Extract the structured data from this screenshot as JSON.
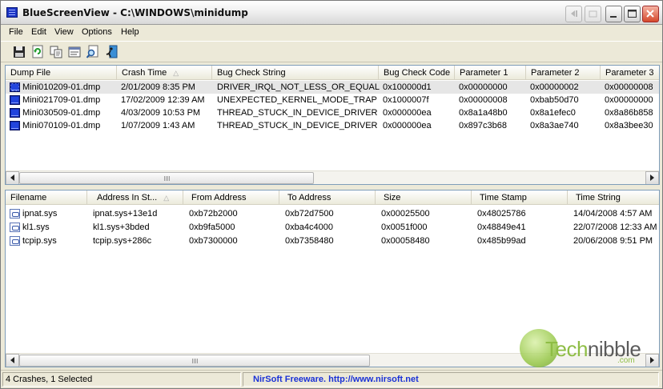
{
  "window": {
    "title": "BlueScreenView  -  C:\\WINDOWS\\minidump",
    "app_icon": "bluescreen-icon",
    "title_buttons": [
      "restore-icon",
      "unknown-icon",
      "minimize-icon",
      "maximize-icon",
      "close-icon"
    ]
  },
  "menu": {
    "file": "File",
    "edit": "Edit",
    "view": "View",
    "options": "Options",
    "help": "Help"
  },
  "toolbar": {
    "icons": [
      "save-icon",
      "refresh-icon",
      "copy-icon",
      "properties-icon",
      "find-icon",
      "exit-icon"
    ]
  },
  "crash_list": {
    "columns": [
      "Dump File",
      "Crash Time",
      "Bug Check String",
      "Bug Check Code",
      "Parameter 1",
      "Parameter 2",
      "Parameter 3"
    ],
    "sorted_column": "Crash Time",
    "rows": [
      [
        "Mini010209-01.dmp",
        "2/01/2009 8:35 PM",
        "DRIVER_IRQL_NOT_LESS_OR_EQUAL",
        "0x100000d1",
        "0x00000000",
        "0x00000002",
        "0x00000008"
      ],
      [
        "Mini021709-01.dmp",
        "17/02/2009 12:39 AM",
        "UNEXPECTED_KERNEL_MODE_TRAP",
        "0x1000007f",
        "0x00000008",
        "0xbab50d70",
        "0x00000000"
      ],
      [
        "Mini030509-01.dmp",
        "4/03/2009 10:53 PM",
        "THREAD_STUCK_IN_DEVICE_DRIVER",
        "0x000000ea",
        "0x8a1a48b0",
        "0x8a1efec0",
        "0x8a86b858"
      ],
      [
        "Mini070109-01.dmp",
        "1/07/2009 1:43 AM",
        "THREAD_STUCK_IN_DEVICE_DRIVER",
        "0x000000ea",
        "0x897c3b68",
        "0x8a3ae740",
        "0x8a3bee30"
      ]
    ],
    "selected_row": 0
  },
  "driver_list": {
    "columns": [
      "Filename",
      "Address In St...",
      "From Address",
      "To Address",
      "Size",
      "Time Stamp",
      "Time String"
    ],
    "sorted_column": "Address In St...",
    "rows": [
      [
        "ipnat.sys",
        "ipnat.sys+13e1d",
        "0xb72b2000",
        "0xb72d7500",
        "0x00025500",
        "0x48025786",
        "14/04/2008 4:57 AM"
      ],
      [
        "kl1.sys",
        "kl1.sys+3bded",
        "0xb9fa5000",
        "0xba4c4000",
        "0x0051f000",
        "0x48849e41",
        "22/07/2008 12:33 AM"
      ],
      [
        "tcpip.sys",
        "tcpip.sys+286c",
        "0xb7300000",
        "0xb7358480",
        "0x00058480",
        "0x485b99ad",
        "20/06/2008 9:51 PM"
      ]
    ]
  },
  "watermark": {
    "part1": "Tech",
    "part2": "nibble",
    "suffix": ".com"
  },
  "status": {
    "left": "4 Crashes, 1 Selected",
    "right": "NirSoft Freeware.  http://www.nirsoft.net"
  },
  "colors": {
    "selected_row": "#e6e6e6",
    "status_link": "#1a31d6"
  }
}
